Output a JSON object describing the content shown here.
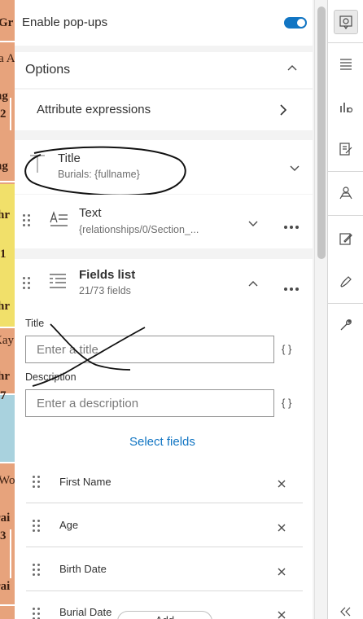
{
  "popups": {
    "enable_label": "Enable pop-ups",
    "enabled": true
  },
  "options": {
    "header": "Options",
    "attribute_expressions": "Attribute expressions"
  },
  "elements": [
    {
      "title": "Title",
      "subtitle": "Burials: {fullname}",
      "icon": "title-icon"
    },
    {
      "title": "Text",
      "subtitle": "{relationships/0/Section_...",
      "icon": "text-icon"
    }
  ],
  "fields_list": {
    "title": "Fields list",
    "count": "21/73 fields",
    "title_label": "Title",
    "title_placeholder": "Enter a title",
    "description_label": "Description",
    "description_placeholder": "Enter a description",
    "expr_icon": "{ }",
    "select_fields": "Select fields",
    "fields": [
      "First Name",
      "Age",
      "Birth Date",
      "Burial Date"
    ],
    "add_label": "Add"
  },
  "colors": {
    "accent": "#1175c3",
    "panel_bg": "#f3f3f3",
    "map_orange": "#e7a37c",
    "map_yellow": "#f1e06a",
    "map_blue": "#a9d2de"
  },
  "map_labels": [
    "Gr",
    "ta A",
    "ng",
    "2",
    "ng",
    "thr",
    "1",
    "thr",
    "Kay",
    "thr",
    "7",
    "Wo",
    "rai",
    "3",
    "rai"
  ]
}
